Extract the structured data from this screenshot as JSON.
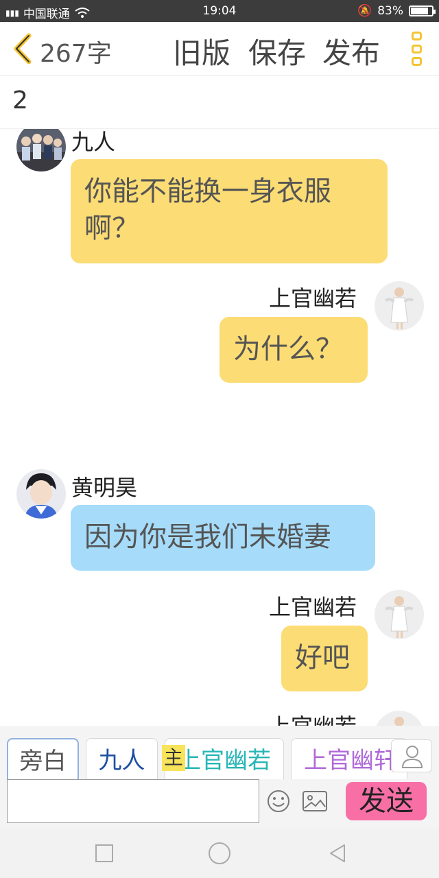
{
  "status": {
    "carrier": "中国联通",
    "network": "4G",
    "time": "19:04",
    "battery": "83%",
    "battery_level": 0.83
  },
  "toolbar": {
    "word_count": "267字",
    "old_version": "旧版",
    "save": "保存",
    "publish": "发布"
  },
  "title": "2",
  "messages": [
    {
      "speaker": "九人",
      "text": "你能不能换一身衣服啊？",
      "side": "left",
      "color": "#fcdc74"
    },
    {
      "speaker": "上官幽若",
      "text": "为什么？",
      "side": "right",
      "color": "#fcdc74"
    },
    {
      "speaker": "黄明昊",
      "text": "因为你是我们未婚妻",
      "side": "left",
      "color": "#a6dcfa"
    },
    {
      "speaker": "上官幽若",
      "text": "好吧",
      "side": "right",
      "color": "#fcdc74"
    },
    {
      "speaker": "上官幽若",
      "text": "",
      "side": "right",
      "color": "#fcdc74"
    }
  ],
  "characters": [
    {
      "label": "旁白",
      "color": "#555555"
    },
    {
      "label": "九人",
      "color": "#1d4fa0"
    },
    {
      "label": "上官幽若",
      "color": "#27b6b6",
      "tag": "主"
    },
    {
      "label": "上官幽轩",
      "color": "#b06ad8"
    }
  ],
  "input": {
    "placeholder": "",
    "value": ""
  },
  "send_label": "发送",
  "icons": {
    "back": "chevron-left-icon",
    "menu": "kebab-menu-icon",
    "emoji": "emoji-icon",
    "image": "image-icon",
    "person": "person-icon"
  }
}
